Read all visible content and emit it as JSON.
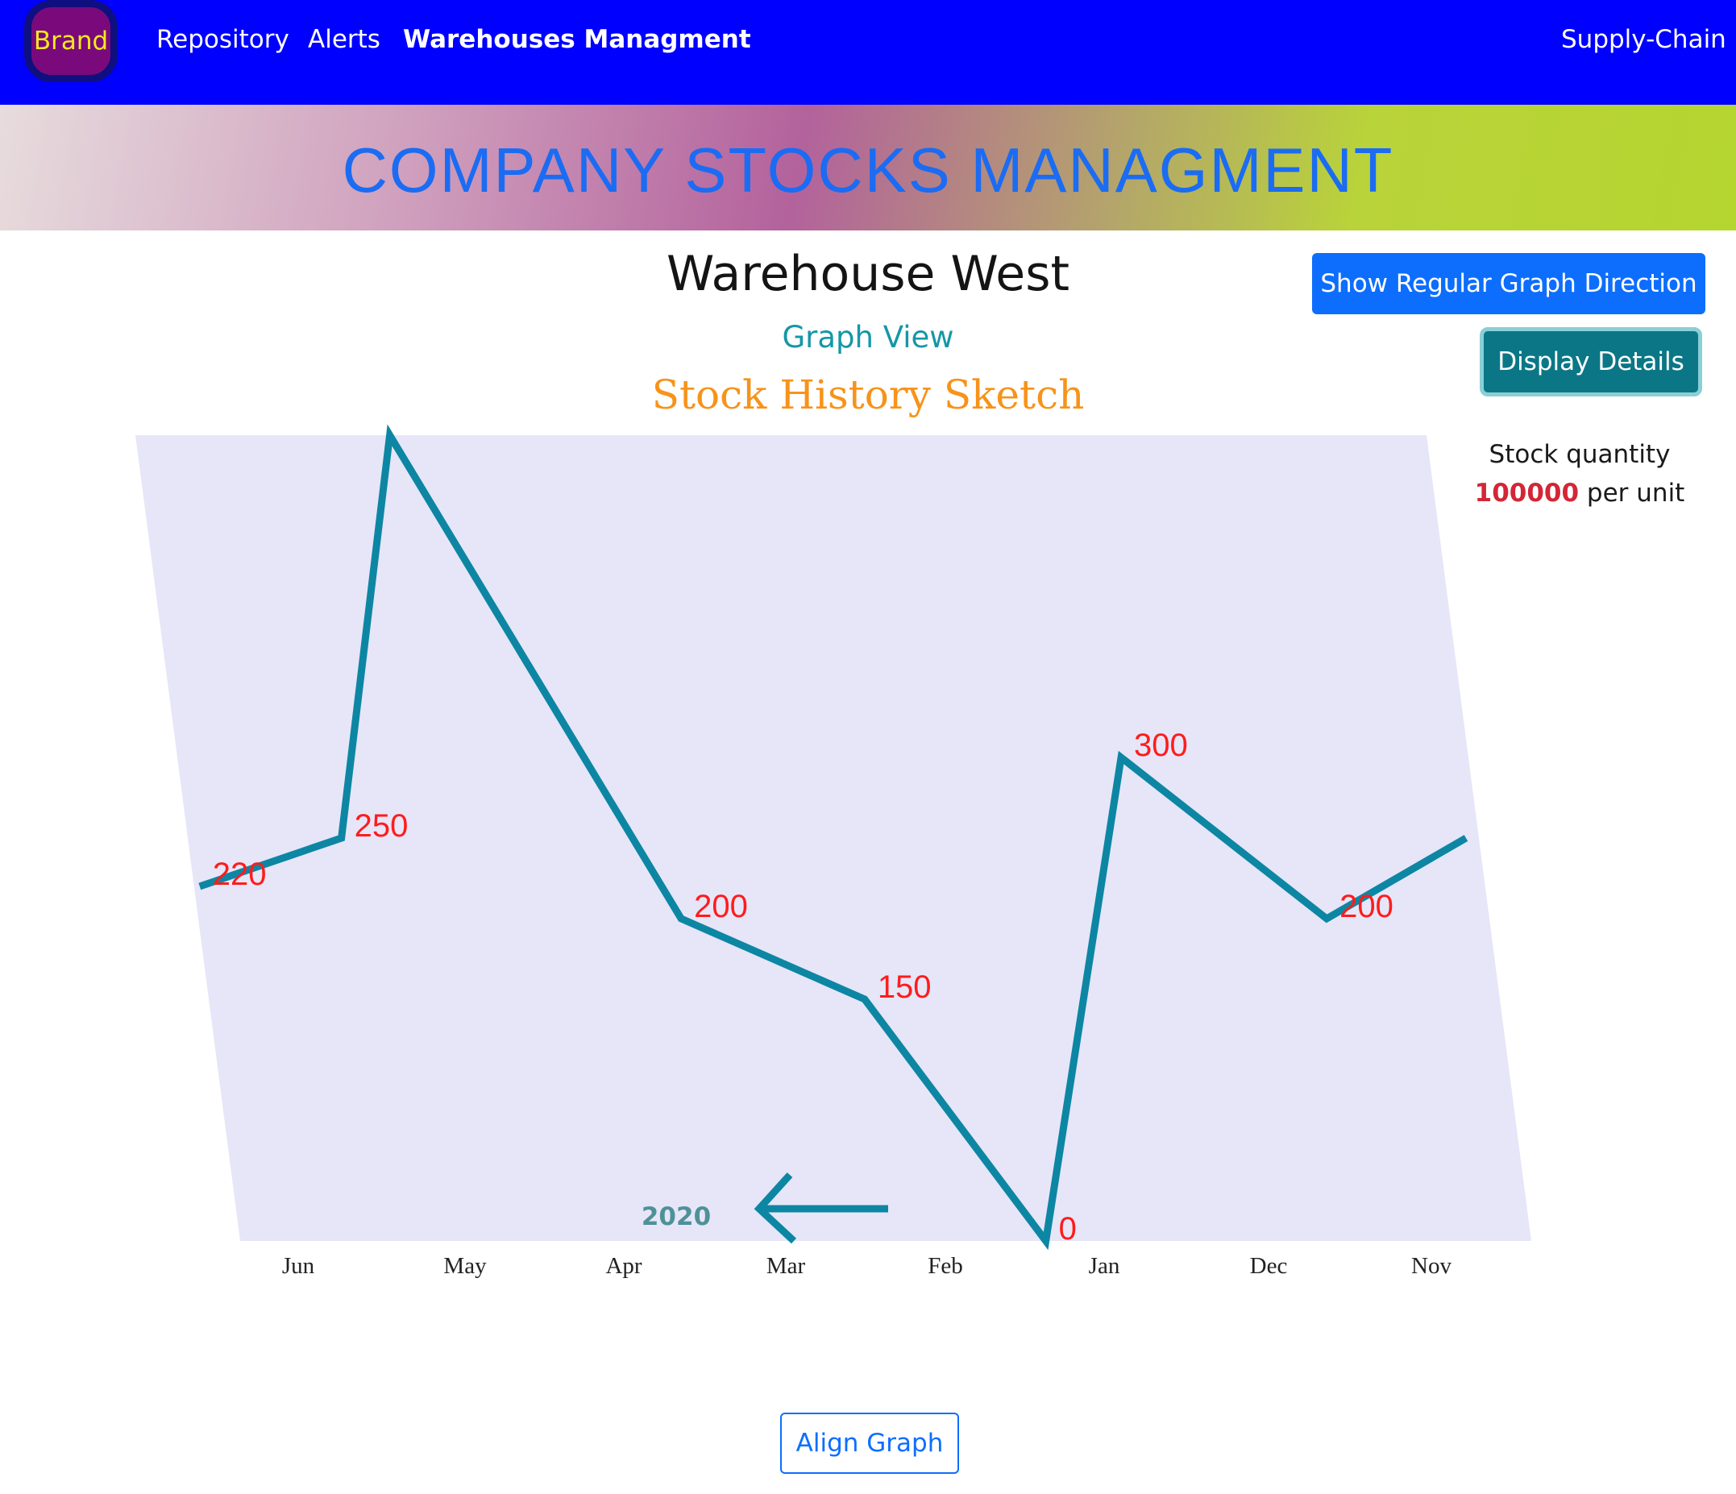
{
  "navbar": {
    "brand": "Brand",
    "links": [
      "Repository",
      "Alerts",
      "Warehouses Managment"
    ],
    "right_link": "Supply-Chain",
    "bg_color": "#0000ff"
  },
  "banner": {
    "title": "COMPANY STOCKS MANAGMENT"
  },
  "main": {
    "warehouse_title": "Warehouse West",
    "view_title": "Graph View",
    "sketch_title": "Stock History Sketch"
  },
  "sidebar": {
    "regular_direction_button": "Show Regular Graph Direction",
    "details_button": "Display Details",
    "quantity_label": "Stock quantity",
    "quantity_value": "100000",
    "quantity_unit": "per unit"
  },
  "footer": {
    "align_button": "Align Graph"
  },
  "chart_data": {
    "type": "line",
    "x_categories": [
      "Jun",
      "May",
      "Apr",
      "Mar",
      "Feb",
      "Jan",
      "Dec",
      "Nov"
    ],
    "points": [
      {
        "x": "Jun",
        "y": 220,
        "label": "220"
      },
      {
        "x": "Jun-May",
        "y": 250,
        "label": "250"
      },
      {
        "x": "May",
        "y": 500,
        "label": ""
      },
      {
        "x": "Apr-Mar",
        "y": 200,
        "label": "200"
      },
      {
        "x": "Mar-Feb",
        "y": 150,
        "label": "150"
      },
      {
        "x": "Feb-Jan",
        "y": 0,
        "label": "0"
      },
      {
        "x": "Jan",
        "y": 300,
        "label": "300"
      },
      {
        "x": "Dec-Nov",
        "y": 200,
        "label": "200"
      },
      {
        "x": "Nov",
        "y": 250,
        "label": ""
      }
    ],
    "ylim": [
      0,
      500
    ],
    "year_label": "2020",
    "direction": "right-to-left",
    "skew": "parallelogram",
    "colors": {
      "line": "#0d86a3",
      "plot_bg": "#e6e6f8",
      "value_label": "#ff1c1c",
      "year": "#4f9198"
    }
  }
}
